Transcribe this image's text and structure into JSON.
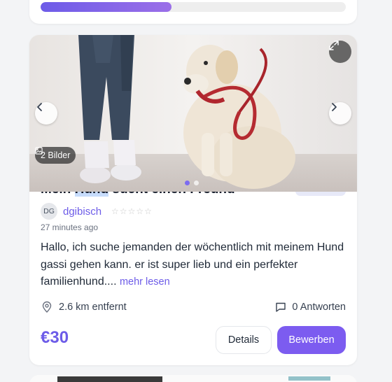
{
  "progress": {
    "fraction": 0.43
  },
  "listing": {
    "image_count_label": "2 Bilder",
    "slide_count": 2,
    "active_slide": 0,
    "title_prefix": "Mein ",
    "title_highlight": "Hund",
    "title_suffix": " sucht einen Freund",
    "author_initials": "DG",
    "author_name": "dgibisch",
    "rating_stars": "☆☆☆☆☆",
    "posted_time": "27 minutes ago",
    "description": "Hallo, ich suche jemanden der wöchentlich mit meinem Hund gassi gehen kann. er ist super lieb und ein perfekter familienhund.... ",
    "more_label": "mehr lesen",
    "distance": "2.6 km entfernt",
    "replies": "0 Antworten",
    "price": "€30",
    "details_label": "Details",
    "apply_label": "Bewerben"
  },
  "icons": {
    "prev": "chevron-left-icon",
    "next": "chevron-right-icon",
    "expand": "expand-icon",
    "images": "image-icon",
    "location": "location-pin-icon",
    "replies": "chat-bubble-icon"
  },
  "colors": {
    "accent": "#6d5ce8",
    "button": "#7c5cf0"
  }
}
